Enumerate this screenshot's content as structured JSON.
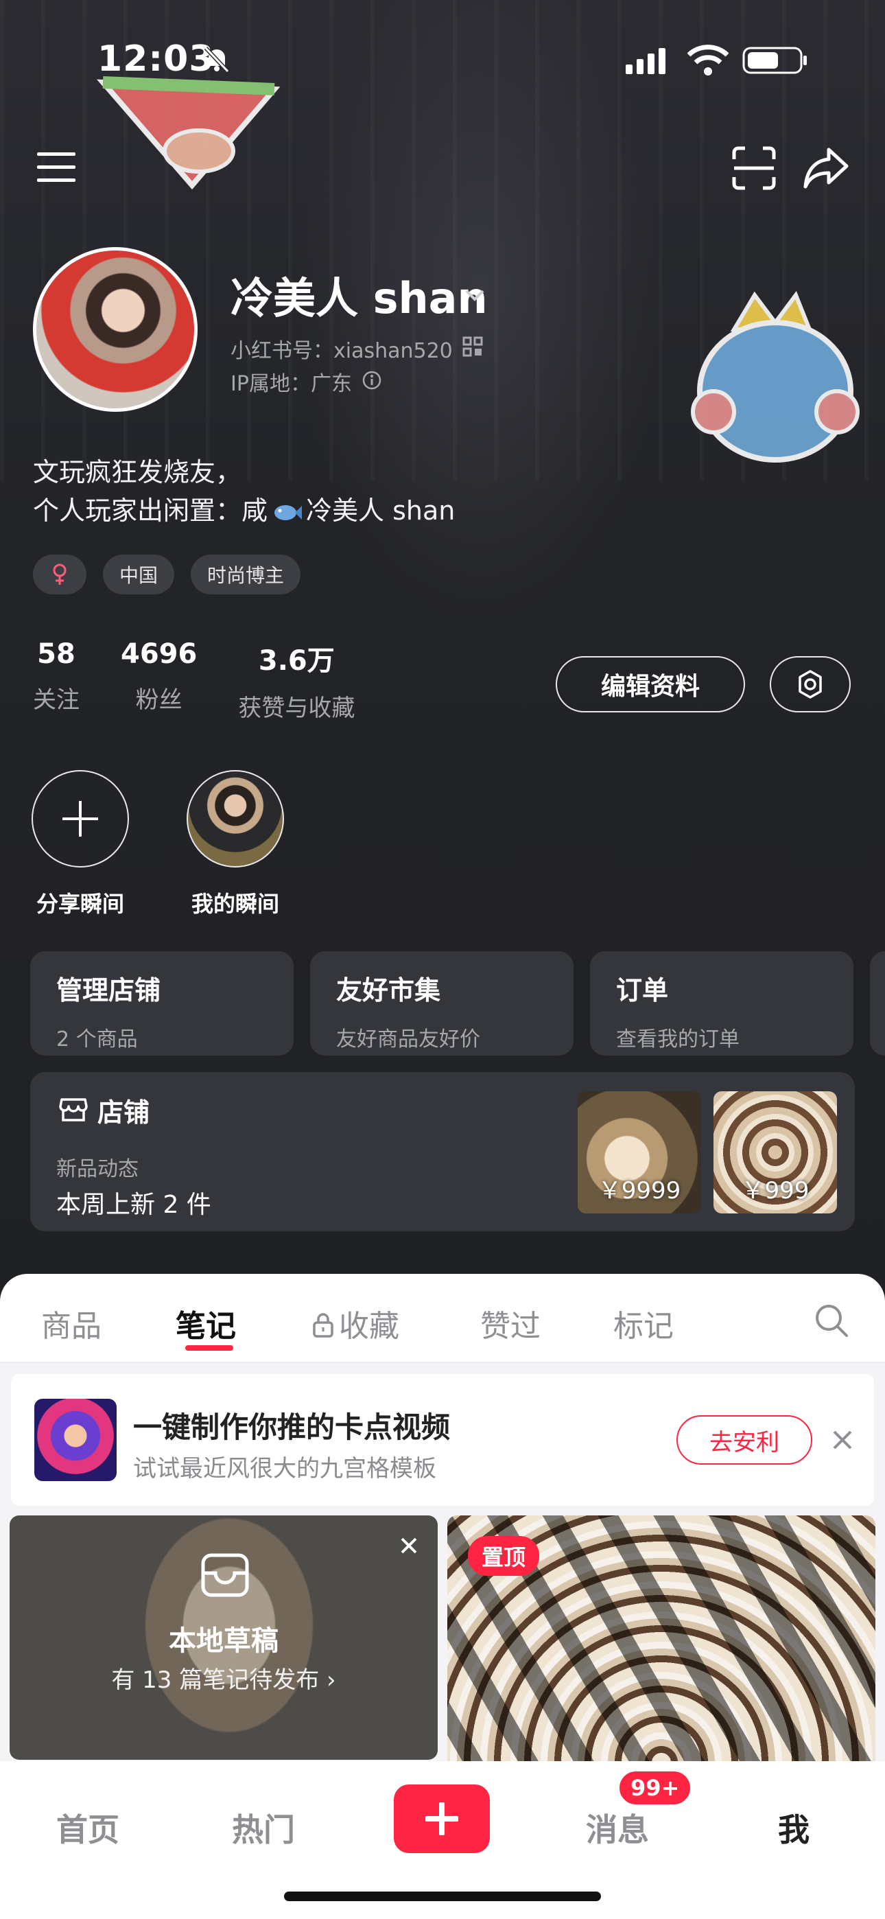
{
  "status_bar": {
    "time": "12:03"
  },
  "profile": {
    "username": "冷美人 shan",
    "redbook_id": "小红书号：xiashan520",
    "ip_location": "IP属地：广东",
    "bio_line1": "文玩疯狂发烧友，",
    "bio_line2_prefix": "个人玩家出闲置：咸",
    "bio_line2_suffix": "冷美人 shan",
    "tags": [
      "中国",
      "时尚博主"
    ],
    "gender_icon": "female-icon"
  },
  "stats": [
    {
      "num": "58",
      "label": "关注"
    },
    {
      "num": "4696",
      "label": "粉丝"
    },
    {
      "num": "3.6万",
      "label": "获赞与收藏"
    }
  ],
  "actions": {
    "edit_label": "编辑资料"
  },
  "moments": {
    "share_label": "分享瞬间",
    "mine_label": "我的瞬间"
  },
  "cards": [
    {
      "title": "管理店铺",
      "sub": "2 个商品"
    },
    {
      "title": "友好市集",
      "sub": "友好商品友好价"
    },
    {
      "title": "订单",
      "sub": "查看我的订单"
    }
  ],
  "shop": {
    "title": "店铺",
    "sub": "新品动态",
    "news": "本周上新 2 件",
    "prices": [
      "￥9999",
      "￥999"
    ]
  },
  "tabs": [
    "商品",
    "笔记",
    "收藏",
    "赞过",
    "标记"
  ],
  "active_tab": "笔记",
  "promo": {
    "title": "一键制作你推的卡点视频",
    "sub": "试试最近风很大的九宫格模板",
    "button": "去安利"
  },
  "draft": {
    "title": "本地草稿",
    "sub": "有 13 篇笔记待发布 ›"
  },
  "pinned_label": "置顶",
  "bottom_nav": {
    "home": "首页",
    "hot": "热门",
    "messages": "消息",
    "messages_badge": "99+",
    "me": "我"
  },
  "colors": {
    "accent": "#ff2442",
    "dark_bg": "#232428",
    "card_bg": "#35363b",
    "muted_text": "#a7a8ad"
  }
}
